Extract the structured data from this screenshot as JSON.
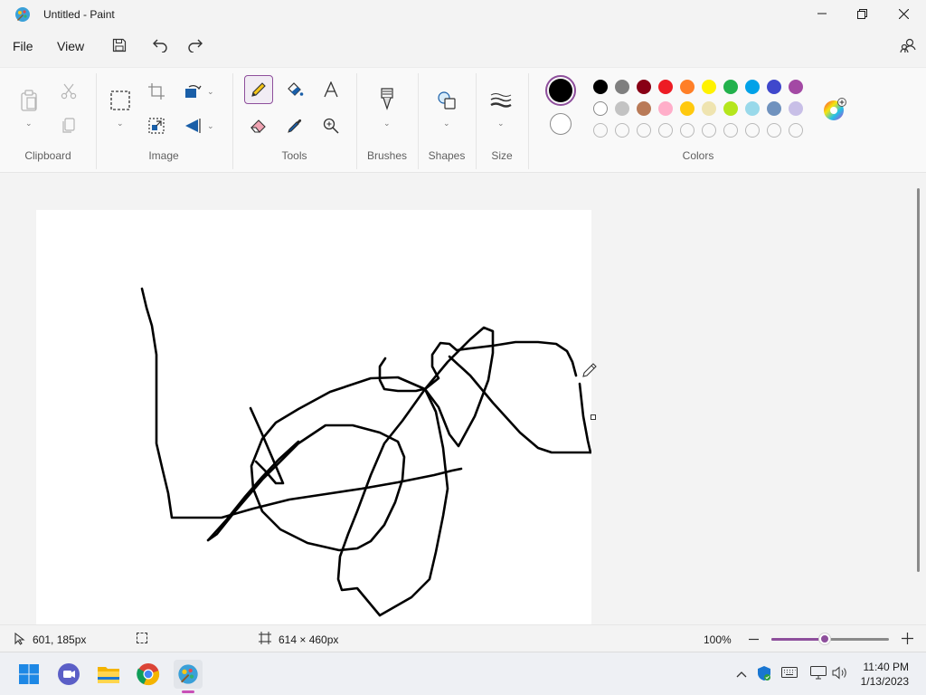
{
  "window": {
    "title": "Untitled - Paint"
  },
  "menu": {
    "file": "File",
    "view": "View"
  },
  "ribbon": {
    "groups": {
      "clipboard": "Clipboard",
      "image": "Image",
      "tools": "Tools",
      "brushes": "Brushes",
      "shapes": "Shapes",
      "size": "Size",
      "colors": "Colors"
    },
    "primary_color": "#000000",
    "secondary_color": "#ffffff",
    "palette_row1": [
      "#000000",
      "#7f7f7f",
      "#880015",
      "#ed1c24",
      "#ff7f27",
      "#fff200",
      "#22b14c",
      "#00a2e8",
      "#3f48cc",
      "#a349a4"
    ],
    "palette_row2": [
      "#ffffff",
      "#c3c3c3",
      "#b97a57",
      "#ffaec9",
      "#ffc90e",
      "#efe4b0",
      "#b5e61d",
      "#99d9ea",
      "#7092be",
      "#c8bfe7"
    ]
  },
  "status": {
    "cursor_pos": "601, 185px",
    "canvas_size": "614 × 460px",
    "zoom": "100%",
    "zoom_fraction": 0.45
  },
  "tray": {
    "time": "11:40 PM",
    "date": "1/13/2023"
  }
}
